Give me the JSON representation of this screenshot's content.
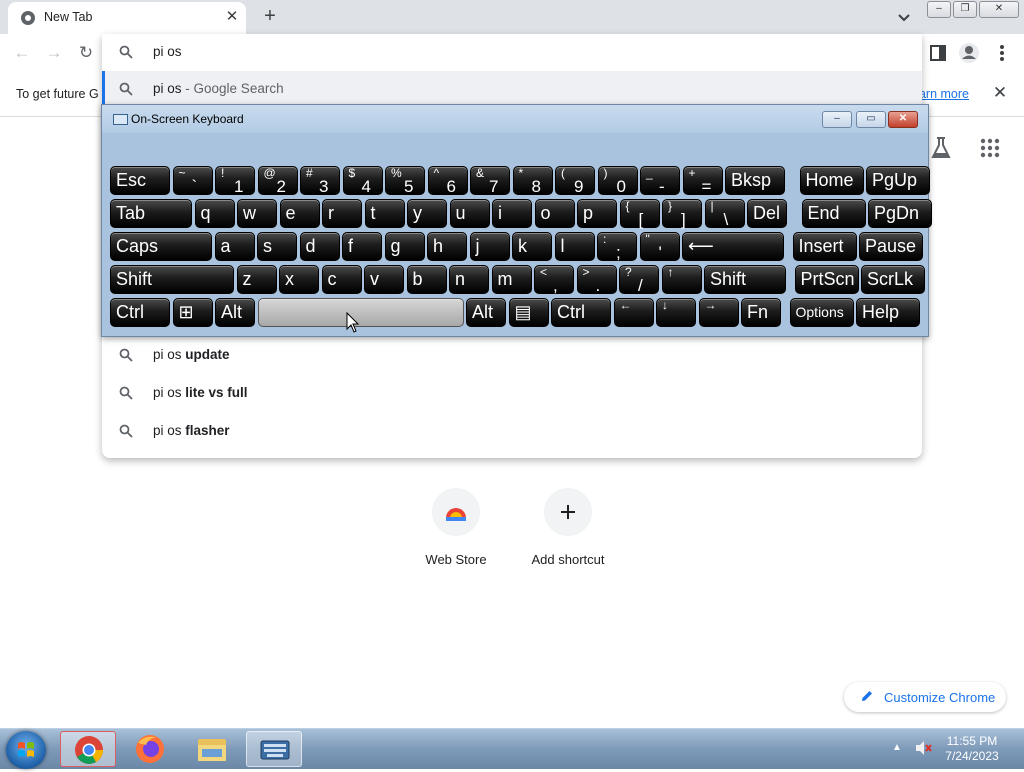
{
  "browser": {
    "tab_title": "New Tab",
    "new_tab_symbol": "+",
    "close_symbol": "✕",
    "window_buttons": [
      "–",
      "❐",
      "✕"
    ]
  },
  "omnibox": {
    "query": "pi os",
    "suggestions": [
      {
        "prefix": "pi os",
        "suffix": " - Google Search",
        "selected": true
      },
      {
        "prefix": "pi os ",
        "bold": "update"
      },
      {
        "prefix": "pi os ",
        "bold": "lite vs full"
      },
      {
        "prefix": "pi os ",
        "bold": "flasher"
      }
    ]
  },
  "infobar": {
    "text": "To get future G",
    "link": "earn more"
  },
  "ntp": {
    "shortcuts": [
      {
        "label": "Web Store",
        "icon": "web-store-icon"
      },
      {
        "label": "Add shortcut",
        "icon": "plus-icon"
      }
    ],
    "customize_label": "Customize Chrome"
  },
  "osk": {
    "title": "On-Screen Keyboard",
    "rows": [
      [
        {
          "m": "Esc"
        },
        {
          "s": "~",
          "b": "`"
        },
        {
          "s": "!",
          "b": "1"
        },
        {
          "s": "@",
          "b": "2"
        },
        {
          "s": "#",
          "b": "3"
        },
        {
          "s": "$",
          "b": "4"
        },
        {
          "s": "%",
          "b": "5"
        },
        {
          "s": "^",
          "b": "6"
        },
        {
          "s": "&",
          "b": "7"
        },
        {
          "s": "*",
          "b": "8"
        },
        {
          "s": "(",
          "b": "9"
        },
        {
          "s": ")",
          "b": "0"
        },
        {
          "s": "_",
          "b": "-"
        },
        {
          "s": "+",
          "b": "="
        },
        {
          "m": "Bksp"
        },
        {
          "m": "Home"
        },
        {
          "m": "PgUp"
        }
      ],
      [
        {
          "m": "Tab"
        },
        {
          "m": "q"
        },
        {
          "m": "w"
        },
        {
          "m": "e"
        },
        {
          "m": "r"
        },
        {
          "m": "t"
        },
        {
          "m": "y"
        },
        {
          "m": "u"
        },
        {
          "m": "i"
        },
        {
          "m": "o"
        },
        {
          "m": "p"
        },
        {
          "s": "{",
          "b": "["
        },
        {
          "s": "}",
          "b": "]"
        },
        {
          "s": "|",
          "b": "\\"
        },
        {
          "m": "Del"
        },
        {
          "m": "End"
        },
        {
          "m": "PgDn"
        }
      ],
      [
        {
          "m": "Caps"
        },
        {
          "m": "a"
        },
        {
          "m": "s"
        },
        {
          "m": "d"
        },
        {
          "m": "f"
        },
        {
          "m": "g"
        },
        {
          "m": "h"
        },
        {
          "m": "j"
        },
        {
          "m": "k"
        },
        {
          "m": "l"
        },
        {
          "s": ":",
          "b": ";"
        },
        {
          "s": "\"",
          "b": "'"
        },
        {
          "m": "⟵"
        },
        {
          "m": "Insert"
        },
        {
          "m": "Pause"
        }
      ],
      [
        {
          "m": "Shift"
        },
        {
          "m": "z"
        },
        {
          "m": "x"
        },
        {
          "m": "c"
        },
        {
          "m": "v"
        },
        {
          "m": "b"
        },
        {
          "m": "n"
        },
        {
          "m": "m"
        },
        {
          "s": "<",
          "b": ","
        },
        {
          "s": ">",
          "b": "."
        },
        {
          "s": "?",
          "b": "/"
        },
        {
          "s": "↑",
          "b": ""
        },
        {
          "m": "Shift"
        },
        {
          "m": "PrtScn"
        },
        {
          "m": "ScrLk"
        }
      ],
      [
        {
          "m": "Ctrl"
        },
        {
          "m": "⊞"
        },
        {
          "m": "Alt"
        },
        {
          "m": ""
        },
        {
          "m": "Alt"
        },
        {
          "m": "▤"
        },
        {
          "m": "Ctrl"
        },
        {
          "s": "←",
          "b": ""
        },
        {
          "s": "↓",
          "b": ""
        },
        {
          "s": "→",
          "b": ""
        },
        {
          "m": "Fn"
        },
        {
          "m": "Options"
        },
        {
          "m": "Help"
        }
      ]
    ]
  },
  "taskbar": {
    "time": "11:55 PM",
    "date": "7/24/2023",
    "apps": [
      "chrome",
      "firefox",
      "file-explorer",
      "on-screen-keyboard"
    ]
  },
  "colors": {
    "accent": "#1a73e8",
    "osk_frame": "#a9c3df",
    "key_face": "#000000"
  }
}
